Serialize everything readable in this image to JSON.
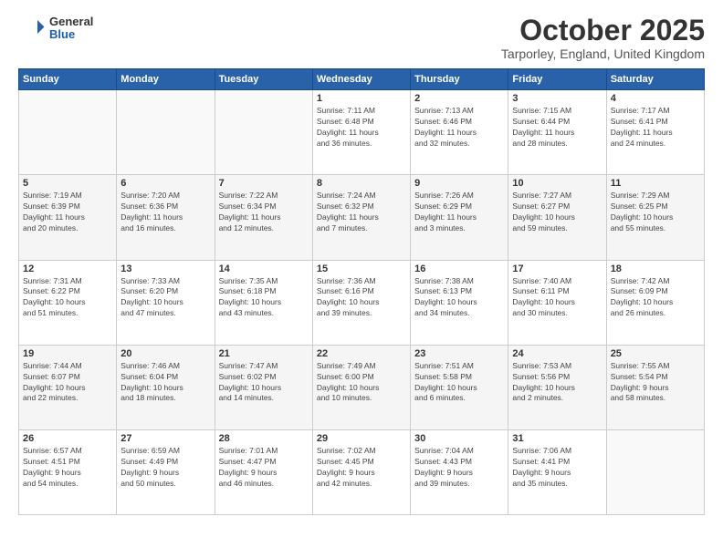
{
  "logo": {
    "general": "General",
    "blue": "Blue"
  },
  "header": {
    "month": "October 2025",
    "location": "Tarporley, England, United Kingdom"
  },
  "weekdays": [
    "Sunday",
    "Monday",
    "Tuesday",
    "Wednesday",
    "Thursday",
    "Friday",
    "Saturday"
  ],
  "weeks": [
    [
      {
        "day": "",
        "info": ""
      },
      {
        "day": "",
        "info": ""
      },
      {
        "day": "",
        "info": ""
      },
      {
        "day": "1",
        "info": "Sunrise: 7:11 AM\nSunset: 6:48 PM\nDaylight: 11 hours\nand 36 minutes."
      },
      {
        "day": "2",
        "info": "Sunrise: 7:13 AM\nSunset: 6:46 PM\nDaylight: 11 hours\nand 32 minutes."
      },
      {
        "day": "3",
        "info": "Sunrise: 7:15 AM\nSunset: 6:44 PM\nDaylight: 11 hours\nand 28 minutes."
      },
      {
        "day": "4",
        "info": "Sunrise: 7:17 AM\nSunset: 6:41 PM\nDaylight: 11 hours\nand 24 minutes."
      }
    ],
    [
      {
        "day": "5",
        "info": "Sunrise: 7:19 AM\nSunset: 6:39 PM\nDaylight: 11 hours\nand 20 minutes."
      },
      {
        "day": "6",
        "info": "Sunrise: 7:20 AM\nSunset: 6:36 PM\nDaylight: 11 hours\nand 16 minutes."
      },
      {
        "day": "7",
        "info": "Sunrise: 7:22 AM\nSunset: 6:34 PM\nDaylight: 11 hours\nand 12 minutes."
      },
      {
        "day": "8",
        "info": "Sunrise: 7:24 AM\nSunset: 6:32 PM\nDaylight: 11 hours\nand 7 minutes."
      },
      {
        "day": "9",
        "info": "Sunrise: 7:26 AM\nSunset: 6:29 PM\nDaylight: 11 hours\nand 3 minutes."
      },
      {
        "day": "10",
        "info": "Sunrise: 7:27 AM\nSunset: 6:27 PM\nDaylight: 10 hours\nand 59 minutes."
      },
      {
        "day": "11",
        "info": "Sunrise: 7:29 AM\nSunset: 6:25 PM\nDaylight: 10 hours\nand 55 minutes."
      }
    ],
    [
      {
        "day": "12",
        "info": "Sunrise: 7:31 AM\nSunset: 6:22 PM\nDaylight: 10 hours\nand 51 minutes."
      },
      {
        "day": "13",
        "info": "Sunrise: 7:33 AM\nSunset: 6:20 PM\nDaylight: 10 hours\nand 47 minutes."
      },
      {
        "day": "14",
        "info": "Sunrise: 7:35 AM\nSunset: 6:18 PM\nDaylight: 10 hours\nand 43 minutes."
      },
      {
        "day": "15",
        "info": "Sunrise: 7:36 AM\nSunset: 6:16 PM\nDaylight: 10 hours\nand 39 minutes."
      },
      {
        "day": "16",
        "info": "Sunrise: 7:38 AM\nSunset: 6:13 PM\nDaylight: 10 hours\nand 34 minutes."
      },
      {
        "day": "17",
        "info": "Sunrise: 7:40 AM\nSunset: 6:11 PM\nDaylight: 10 hours\nand 30 minutes."
      },
      {
        "day": "18",
        "info": "Sunrise: 7:42 AM\nSunset: 6:09 PM\nDaylight: 10 hours\nand 26 minutes."
      }
    ],
    [
      {
        "day": "19",
        "info": "Sunrise: 7:44 AM\nSunset: 6:07 PM\nDaylight: 10 hours\nand 22 minutes."
      },
      {
        "day": "20",
        "info": "Sunrise: 7:46 AM\nSunset: 6:04 PM\nDaylight: 10 hours\nand 18 minutes."
      },
      {
        "day": "21",
        "info": "Sunrise: 7:47 AM\nSunset: 6:02 PM\nDaylight: 10 hours\nand 14 minutes."
      },
      {
        "day": "22",
        "info": "Sunrise: 7:49 AM\nSunset: 6:00 PM\nDaylight: 10 hours\nand 10 minutes."
      },
      {
        "day": "23",
        "info": "Sunrise: 7:51 AM\nSunset: 5:58 PM\nDaylight: 10 hours\nand 6 minutes."
      },
      {
        "day": "24",
        "info": "Sunrise: 7:53 AM\nSunset: 5:56 PM\nDaylight: 10 hours\nand 2 minutes."
      },
      {
        "day": "25",
        "info": "Sunrise: 7:55 AM\nSunset: 5:54 PM\nDaylight: 9 hours\nand 58 minutes."
      }
    ],
    [
      {
        "day": "26",
        "info": "Sunrise: 6:57 AM\nSunset: 4:51 PM\nDaylight: 9 hours\nand 54 minutes."
      },
      {
        "day": "27",
        "info": "Sunrise: 6:59 AM\nSunset: 4:49 PM\nDaylight: 9 hours\nand 50 minutes."
      },
      {
        "day": "28",
        "info": "Sunrise: 7:01 AM\nSunset: 4:47 PM\nDaylight: 9 hours\nand 46 minutes."
      },
      {
        "day": "29",
        "info": "Sunrise: 7:02 AM\nSunset: 4:45 PM\nDaylight: 9 hours\nand 42 minutes."
      },
      {
        "day": "30",
        "info": "Sunrise: 7:04 AM\nSunset: 4:43 PM\nDaylight: 9 hours\nand 39 minutes."
      },
      {
        "day": "31",
        "info": "Sunrise: 7:06 AM\nSunset: 4:41 PM\nDaylight: 9 hours\nand 35 minutes."
      },
      {
        "day": "",
        "info": ""
      }
    ]
  ]
}
